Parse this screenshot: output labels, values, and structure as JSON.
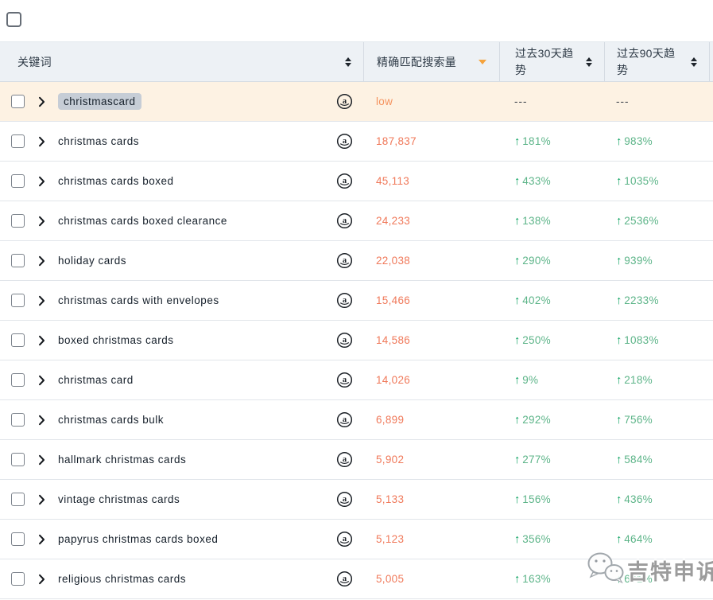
{
  "colors": {
    "header_bg": "#edf1f5",
    "row_highlight_bg": "#fdf2e3",
    "keyword_tag_bg": "#c6cdd6",
    "volume_orange": "#f0795a",
    "trend_arrow_green": "#09a05e",
    "trend_text_green": "#5cb488",
    "sort_active_orange": "#f5a33c"
  },
  "icons": {
    "up_arrow": "↑",
    "sort_asc": "▲",
    "sort_desc": "▼"
  },
  "header": {
    "columns": [
      {
        "label": "关键词",
        "sort_state": "none"
      },
      {
        "label": "精确匹配搜索量",
        "sort_state": "desc"
      },
      {
        "label": "过去30天趋势",
        "sort_state": "none"
      },
      {
        "label": "过去90天趋势",
        "sort_state": "none"
      }
    ]
  },
  "rows": [
    {
      "keyword": "christmascard",
      "tagged": true,
      "highlighted": true,
      "volume": "low",
      "volume_low": true,
      "trend30": "---",
      "trend90": "---"
    },
    {
      "keyword": "christmas cards",
      "volume": "187,837",
      "trend30": "181%",
      "trend90": "983%"
    },
    {
      "keyword": "christmas cards boxed",
      "volume": "45,113",
      "trend30": "433%",
      "trend90": "1035%"
    },
    {
      "keyword": "christmas cards boxed clearance",
      "volume": "24,233",
      "trend30": "138%",
      "trend90": "2536%"
    },
    {
      "keyword": "holiday cards",
      "volume": "22,038",
      "trend30": "290%",
      "trend90": "939%"
    },
    {
      "keyword": "christmas cards with envelopes",
      "volume": "15,466",
      "trend30": "402%",
      "trend90": "2233%"
    },
    {
      "keyword": "boxed christmas cards",
      "volume": "14,586",
      "trend30": "250%",
      "trend90": "1083%"
    },
    {
      "keyword": "christmas card",
      "volume": "14,026",
      "trend30": "9%",
      "trend90": "218%"
    },
    {
      "keyword": "christmas cards bulk",
      "volume": "6,899",
      "trend30": "292%",
      "trend90": "756%"
    },
    {
      "keyword": "hallmark christmas cards",
      "volume": "5,902",
      "trend30": "277%",
      "trend90": "584%"
    },
    {
      "keyword": "vintage christmas cards",
      "volume": "5,133",
      "trend30": "156%",
      "trend90": "436%"
    },
    {
      "keyword": "papyrus christmas cards boxed",
      "volume": "5,123",
      "trend30": "356%",
      "trend90": "464%"
    },
    {
      "keyword": "religious christmas cards",
      "volume": "5,005",
      "trend30": "163%",
      "trend90": "671%"
    }
  ],
  "watermark": {
    "text": "吉特申诉"
  }
}
